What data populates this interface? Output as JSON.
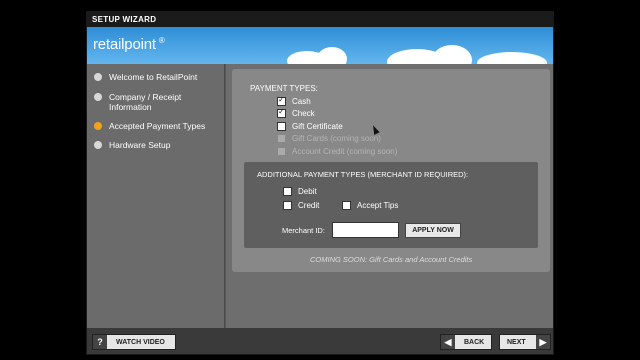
{
  "window": {
    "title": "SETUP WIZARD"
  },
  "brand": {
    "name": "retailpoint",
    "mark": "®"
  },
  "steps": [
    {
      "label": "Welcome to RetailPoint",
      "active": false
    },
    {
      "label": "Company / Receipt Information",
      "active": false
    },
    {
      "label": "Accepted Payment Types",
      "active": true
    },
    {
      "label": "Hardware Setup",
      "active": false
    }
  ],
  "payment": {
    "title": "PAYMENT TYPES:",
    "options": [
      {
        "label": "Cash",
        "checked": true,
        "disabled": false
      },
      {
        "label": "Check",
        "checked": true,
        "disabled": false
      },
      {
        "label": "Gift Certificate",
        "checked": false,
        "disabled": false
      },
      {
        "label": "Gift Cards (coming soon)",
        "checked": false,
        "disabled": true
      },
      {
        "label": "Account Credit (coming soon)",
        "checked": false,
        "disabled": true
      }
    ]
  },
  "additional": {
    "title": "ADDITIONAL PAYMENT TYPES (MERCHANT ID REQUIRED):",
    "debit": "Debit",
    "credit": "Credit",
    "accept_tips": "Accept Tips",
    "merchant_label": "Merchant ID:",
    "merchant_value": "",
    "apply_label": "APPLY NOW"
  },
  "coming_soon": "COMING SOON: Gift Cards and Account Credits",
  "footer": {
    "help_icon": "?",
    "watch_label": "WATCH VIDEO",
    "back_label": "BACK",
    "next_label": "NEXT"
  },
  "icons": {
    "back": "chevron-left-icon",
    "next": "chevron-right-icon",
    "help": "question-icon"
  },
  "colors": {
    "banner": "#4aa6e6",
    "active_step": "#f2a21b"
  }
}
